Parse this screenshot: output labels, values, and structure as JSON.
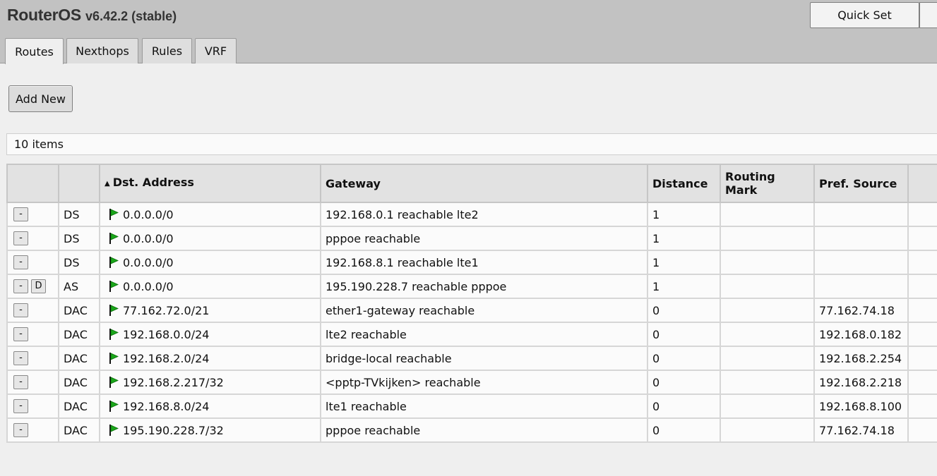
{
  "app": {
    "title": "RouterOS",
    "version": "v6.42.2 (stable)"
  },
  "header": {
    "quick_set": "Quick Set"
  },
  "tabs": [
    {
      "label": "Routes",
      "active": true
    },
    {
      "label": "Nexthops",
      "active": false
    },
    {
      "label": "Rules",
      "active": false
    },
    {
      "label": "VRF",
      "active": false
    }
  ],
  "toolbar": {
    "add_new": "Add New"
  },
  "list": {
    "count": "10 items"
  },
  "table": {
    "headers": {
      "dst": "Dst. Address",
      "gateway": "Gateway",
      "distance": "Distance",
      "routing_mark": "Routing Mark",
      "pref_source": "Pref. Source"
    },
    "sorted_column": "Dst. Address",
    "rows": [
      {
        "btn_remove": "-",
        "btn_disable": "",
        "flags": "DS",
        "dst": "0.0.0.0/0",
        "gateway": "192.168.0.1 reachable lte2",
        "distance": "1",
        "routing_mark": "",
        "pref_source": ""
      },
      {
        "btn_remove": "-",
        "btn_disable": "",
        "flags": "DS",
        "dst": "0.0.0.0/0",
        "gateway": "pppoe reachable",
        "distance": "1",
        "routing_mark": "",
        "pref_source": ""
      },
      {
        "btn_remove": "-",
        "btn_disable": "",
        "flags": "DS",
        "dst": "0.0.0.0/0",
        "gateway": "192.168.8.1 reachable lte1",
        "distance": "1",
        "routing_mark": "",
        "pref_source": ""
      },
      {
        "btn_remove": "-",
        "btn_disable": "D",
        "flags": "AS",
        "dst": "0.0.0.0/0",
        "gateway": "195.190.228.7 reachable pppoe",
        "distance": "1",
        "routing_mark": "",
        "pref_source": ""
      },
      {
        "btn_remove": "-",
        "btn_disable": "",
        "flags": "DAC",
        "dst": "77.162.72.0/21",
        "gateway": "ether1-gateway reachable",
        "distance": "0",
        "routing_mark": "",
        "pref_source": "77.162.74.18"
      },
      {
        "btn_remove": "-",
        "btn_disable": "",
        "flags": "DAC",
        "dst": "192.168.0.0/24",
        "gateway": "lte2 reachable",
        "distance": "0",
        "routing_mark": "",
        "pref_source": "192.168.0.182"
      },
      {
        "btn_remove": "-",
        "btn_disable": "",
        "flags": "DAC",
        "dst": "192.168.2.0/24",
        "gateway": "bridge-local reachable",
        "distance": "0",
        "routing_mark": "",
        "pref_source": "192.168.2.254"
      },
      {
        "btn_remove": "-",
        "btn_disable": "",
        "flags": "DAC",
        "dst": "192.168.2.217/32",
        "gateway": "<pptp-TVkijken> reachable",
        "distance": "0",
        "routing_mark": "",
        "pref_source": "192.168.2.218"
      },
      {
        "btn_remove": "-",
        "btn_disable": "",
        "flags": "DAC",
        "dst": "192.168.8.0/24",
        "gateway": "lte1 reachable",
        "distance": "0",
        "routing_mark": "",
        "pref_source": "192.168.8.100"
      },
      {
        "btn_remove": "-",
        "btn_disable": "",
        "flags": "DAC",
        "dst": "195.190.228.7/32",
        "gateway": "pppoe reachable",
        "distance": "0",
        "routing_mark": "",
        "pref_source": "77.162.74.18"
      }
    ]
  },
  "icons": {
    "route_flag": "green-flag-icon",
    "sort": "sort-ascending-icon"
  },
  "colors": {
    "flag": "#1aa61a",
    "header_bar": "#c2c2c2"
  }
}
